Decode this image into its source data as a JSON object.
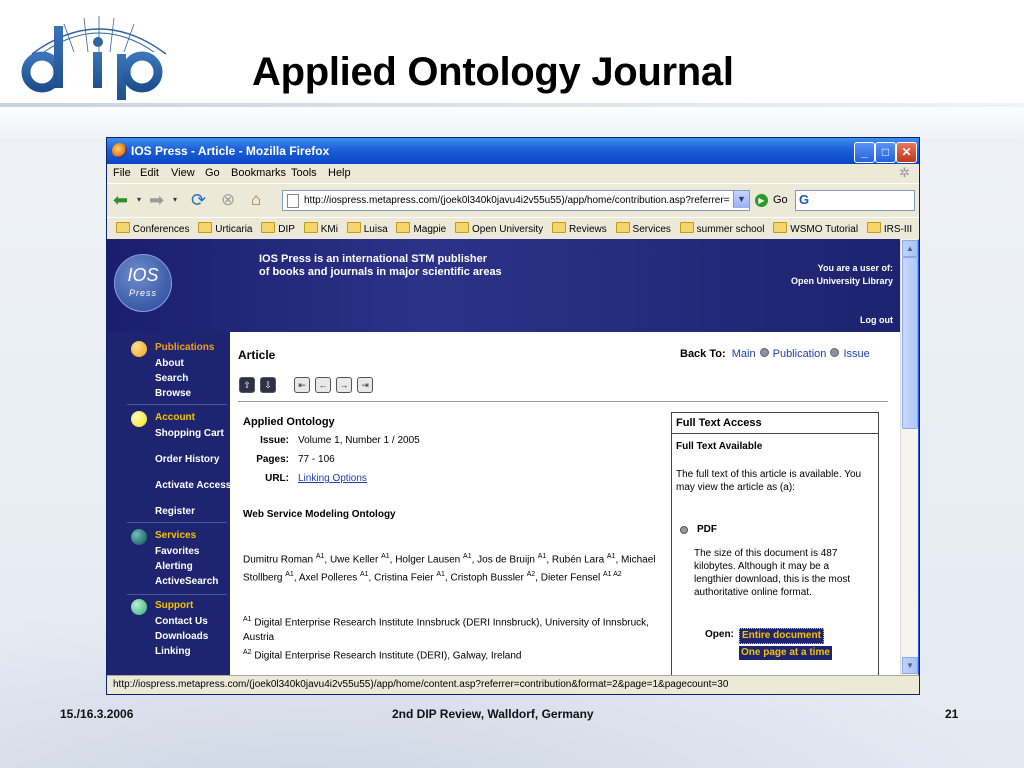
{
  "slide": {
    "title": "Applied Ontology Journal",
    "logo_text": "dip",
    "footer_left": "15./16.3.2006",
    "footer_center": "2nd DIP Review, Walldorf, Germany",
    "footer_right": "21"
  },
  "browser": {
    "window_title": "IOS Press - Article - Mozilla Firefox",
    "menu": [
      "File",
      "Edit",
      "View",
      "Go",
      "Bookmarks",
      "Tools",
      "Help"
    ],
    "url": "http://iospress.metapress.com/(joek0l340k0javu4i2v55u55)/app/home/contribution.asp?referrer=",
    "go_label": "Go",
    "bookmarks": [
      "Conferences",
      "Urticaria",
      "DIP",
      "KMi",
      "Luisa",
      "Magpie",
      "Open University",
      "Reviews",
      "Services",
      "summer school",
      "WSMO Tutorial",
      "IRS-III"
    ],
    "status_text": "http://iospress.metapress.com/(joek0l340k0javu4i2v55u55)/app/home/content.asp?referrer=contribution&format=2&page=1&pagecount=30"
  },
  "page": {
    "logo_main": "IOS",
    "logo_sub": "Press",
    "tagline_1": "IOS Press is an international STM publisher",
    "tagline_2": "of books and journals in major scientific areas",
    "user_line_1": "You are a user of:",
    "user_line_2": "Open University Library",
    "logout": "Log out",
    "sidebar": {
      "publications": {
        "head": "Publications",
        "items": [
          "About",
          "Search",
          "Browse"
        ]
      },
      "account": {
        "head": "Account",
        "items": [
          "Shopping Cart",
          "Order History",
          "Activate Access",
          "Register"
        ]
      },
      "services": {
        "head": "Services",
        "items": [
          "Favorites",
          "Alerting",
          "ActiveSearch"
        ]
      },
      "support": {
        "head": "Support",
        "items": [
          "Contact Us",
          "Downloads",
          "Linking"
        ]
      }
    },
    "article_label": "Article",
    "back_to": "Back To:",
    "back_links": [
      "Main",
      "Publication",
      "Issue"
    ],
    "journal": "Applied Ontology",
    "issue_label": "Issue:",
    "issue_value": "Volume 1, Number 1 / 2005",
    "pages_label": "Pages:",
    "pages_value": "77 - 106",
    "url_label": "URL:",
    "url_value": "Linking Options",
    "article_title": "Web Service Modeling Ontology",
    "authors": [
      {
        "name": "Dumitru Roman",
        "aff": "A1"
      },
      {
        "name": "Uwe Keller",
        "aff": "A1"
      },
      {
        "name": "Holger Lausen",
        "aff": "A1"
      },
      {
        "name": "Jos de Bruijn",
        "aff": "A1"
      },
      {
        "name": "Rubén Lara",
        "aff": "A1"
      },
      {
        "name": "Michael Stollberg",
        "aff": "A1"
      },
      {
        "name": "Axel Polleres",
        "aff": "A1"
      },
      {
        "name": "Cristina Feier",
        "aff": "A1"
      },
      {
        "name": "Cristoph Bussler",
        "aff": "A2"
      },
      {
        "name": "Dieter Fensel",
        "aff": "A1 A2"
      }
    ],
    "affiliations": [
      {
        "id": "A1",
        "text": "Digital Enterprise Research Institute Innsbruck (DERI Innsbruck), University of Innsbruck, Austria"
      },
      {
        "id": "A2",
        "text": "Digital Enterprise Research Institute (DERI), Galway, Ireland"
      }
    ],
    "fulltext": {
      "title": "Full Text Access",
      "available": "Full Text Available",
      "desc": "The full text of this article is available. You may view the article as (a):",
      "format": "PDF",
      "size_note": "The size of this document is 487 kilobytes. Although it may be a lengthier download, this is the most authoritative online format.",
      "open_label": "Open:",
      "open_entire": "Entire document",
      "open_page": "One page at a time"
    }
  },
  "colors": {
    "ios_navy": "#1f2470",
    "ios_gold": "#f5c400",
    "link_blue": "#1d3fb1",
    "xp_blue": "#1c5fd8",
    "dot_publications": "#f0a020",
    "dot_account": "#f5e020",
    "dot_services": "#1a6a6a",
    "dot_support": "#40c080"
  }
}
